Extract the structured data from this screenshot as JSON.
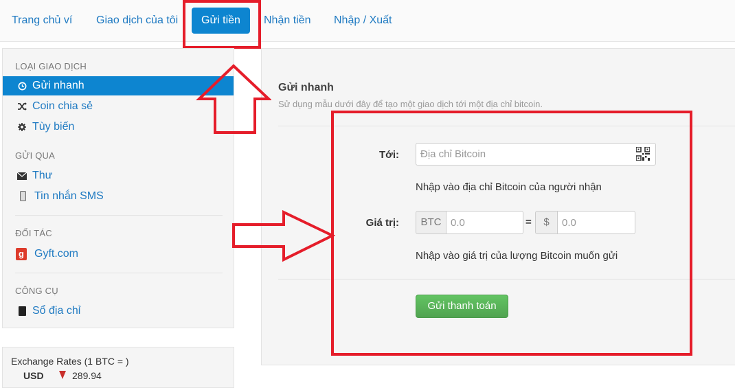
{
  "nav": {
    "tabs": [
      {
        "label": "Trang chủ ví"
      },
      {
        "label": "Giao dịch của tôi"
      },
      {
        "label": "Gửi tiền"
      },
      {
        "label": "Nhận tiền"
      },
      {
        "label": "Nhập / Xuất"
      }
    ],
    "active_index": 2
  },
  "sidebar": {
    "sections": [
      {
        "header": "LOẠI GIAO DỊCH",
        "items": [
          {
            "label": "Gửi nhanh",
            "icon": "clock-icon",
            "active": true
          },
          {
            "label": "Coin chia sẻ",
            "icon": "shuffle-icon"
          },
          {
            "label": "Tùy biến",
            "icon": "gear-icon"
          }
        ]
      },
      {
        "header": "GỬI QUA",
        "items": [
          {
            "label": "Thư",
            "icon": "envelope-icon"
          },
          {
            "label": "Tin nhắn SMS",
            "icon": "phone-icon"
          }
        ]
      },
      {
        "header": "ĐỐI TÁC",
        "items": [
          {
            "label": "Gyft.com",
            "icon": "gyft-icon"
          }
        ]
      },
      {
        "header": "CÔNG CỤ",
        "items": [
          {
            "label": "Sổ địa chỉ",
            "icon": "book-icon"
          }
        ]
      }
    ]
  },
  "rates": {
    "title": "Exchange Rates (1 BTC = )",
    "currency": "USD",
    "value": "289.94"
  },
  "form": {
    "title": "Gửi nhanh",
    "subtitle": "Sử dụng mẫu dưới đây để tạo một giao dịch tới một địa chỉ bitcoin.",
    "to_label": "Tới:",
    "to_placeholder": "Địa chỉ Bitcoin",
    "to_help": "Nhập vào địa chỉ Bitcoin của người nhận",
    "amount_label": "Giá trị:",
    "btc_addon": "BTC",
    "btc_placeholder": "0.0",
    "equals": "=",
    "usd_addon": "$",
    "usd_placeholder": "0.0",
    "amount_help": "Nhập vào giá trị của lượng Bitcoin muốn gửi",
    "send_button": "Gửi thanh toán"
  },
  "colors": {
    "accent": "#0d85d0",
    "link": "#1f7ac2",
    "annotation": "#e51d2a",
    "send_button": "#5cb85c"
  }
}
